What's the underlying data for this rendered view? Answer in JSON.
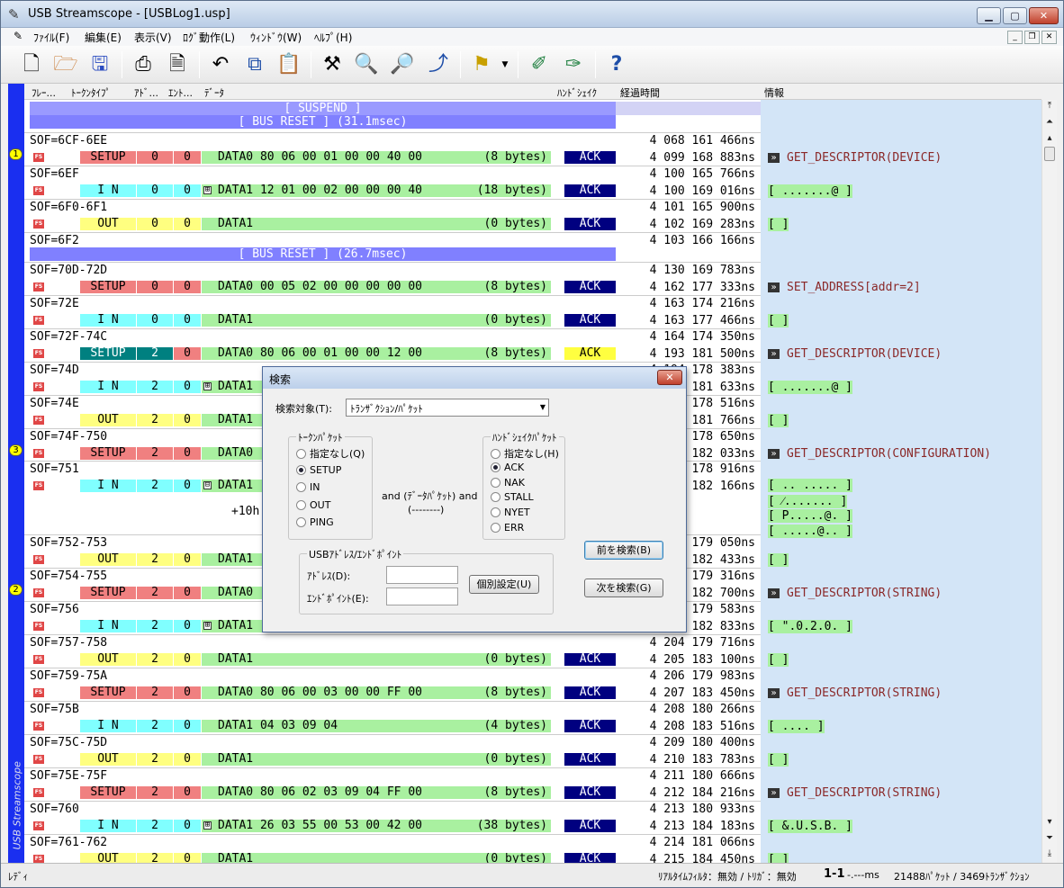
{
  "window": {
    "title": "USB Streamscope - [USBLog1.usp]"
  },
  "menu": [
    "ﾌｧｲﾙ(F)",
    "編集(E)",
    "表示(V)",
    "ﾛｸﾞ動作(L)",
    "ｳｨﾝﾄﾞｳ(W)",
    "ﾍﾙﾌﾟ(H)"
  ],
  "columns": {
    "frame": "ﾌﾚｰ...",
    "token": "ﾄｰｸﾝﾀｲﾌﾟ",
    "addr": "ｱﾄﾞ...",
    "ep": "ｴﾝﾄ...",
    "data": "ﾃﾞｰﾀ",
    "handshake": "ﾊﾝﾄﾞｼｪｲｸ",
    "time": "経過時間",
    "info": "情報"
  },
  "sidebar_label": "USB Streamscope",
  "fs_badge": "FS",
  "banners": [
    {
      "text": "[ SUSPEND ]"
    },
    {
      "text": "[ BUS RESET ] (31.1msec)"
    },
    {
      "text": "[ BUS RESET ] (26.7msec)"
    }
  ],
  "bubbles": [
    "1",
    "3",
    "2"
  ],
  "frames": [
    {
      "sof": "SOF=6CF-6EE",
      "t1": "4 068 161 466ns",
      "pid": "SETUP",
      "addr": "0",
      "ep": "0",
      "data": "DATA0 80 06 00 01 00 00 40 00",
      "size": "(8 bytes)",
      "hs": "ACK",
      "t2": "4 099 168 883ns",
      "info": "GET_DESCRIPTOR(DEVICE)"
    },
    {
      "sof": "SOF=6EF",
      "t1": "4 100 165 766ns",
      "pid": "I N",
      "addr": "0",
      "ep": "0",
      "plus": "⊞",
      "data": "DATA1 12 01 00 02 00 00 00 40",
      "size": "(18 bytes)",
      "hs": "ACK",
      "t2": "4 100 169 016ns",
      "info": "[ .......@ ]"
    },
    {
      "sof": "SOF=6F0-6F1",
      "t1": "4 101 165 900ns",
      "pid": "OUT",
      "addr": "0",
      "ep": "0",
      "data": "DATA1",
      "size": "(0 bytes)",
      "hs": "ACK",
      "t2": "4 102 169 283ns",
      "info": "[  ]"
    },
    {
      "sof": "SOF=6F2",
      "t1": "4 103 166 166ns"
    },
    {
      "sof": "SOF=70D-72D",
      "t1": "4 130 169 783ns",
      "pid": "SETUP",
      "addr": "0",
      "ep": "0",
      "data": "DATA0 00 05 02 00 00 00 00 00",
      "size": "(8 bytes)",
      "hs": "ACK",
      "t2": "4 162 177 333ns",
      "info": "SET_ADDRESS[addr=2]"
    },
    {
      "sof": "SOF=72E",
      "t1": "4 163 174 216ns",
      "pid": "I N",
      "addr": "0",
      "ep": "0",
      "data": "DATA1",
      "size": "(0 bytes)",
      "hs": "ACK",
      "t2": "4 163 177 466ns",
      "info": "[  ]"
    },
    {
      "sof": "SOF=72F-74C",
      "t1": "4 164 174 350ns",
      "pid": "SETUP",
      "addr": "2",
      "ep": "0",
      "data": "DATA0 80 06 00 01 00 00 12 00",
      "size": "(8 bytes)",
      "hs": "ACK",
      "t2": "4 193 181 500ns",
      "info": "GET_DESCRIPTOR(DEVICE)"
    },
    {
      "sof": "SOF=74D",
      "t1": "4 194 178 383ns",
      "pid": "I N",
      "addr": "2",
      "ep": "0",
      "plus": "⊞",
      "data": "DATA1",
      "size": "",
      "hs": "",
      "t2": "4 194 181 633ns",
      "info": "[ .......@ ]"
    },
    {
      "sof": "SOF=74E",
      "t1": "4 195 178 516ns",
      "pid": "OUT",
      "addr": "2",
      "ep": "0",
      "data": "DATA1",
      "size": "",
      "hs": "",
      "t2": "4 196 181 766ns",
      "info": "[  ]"
    },
    {
      "sof": "SOF=74F-750",
      "t1": "4 197 178 650ns",
      "pid": "SETUP",
      "addr": "2",
      "ep": "0",
      "data": "DATA0",
      "size": "",
      "hs": "",
      "t2": "4 198 182 033ns",
      "info": "GET_DESCRIPTOR(CONFIGURATION)"
    },
    {
      "sof": "SOF=751",
      "t1": "4 199 178 916ns",
      "pid": "I N",
      "addr": "2",
      "ep": "0",
      "plus": "⊟",
      "data": "DATA1",
      "size": "",
      "hs": "",
      "t2": "4 200 182 166ns",
      "extra": "+10h",
      "info_lines": [
        "[ .. ..... ]",
        "[ ⁄....... ]",
        "[ P.....@. ]",
        "[ .....@.. ]"
      ]
    },
    {
      "sof": "SOF=752-753",
      "t1": "4 201 179 050ns",
      "pid": "OUT",
      "addr": "2",
      "ep": "0",
      "data": "DATA1",
      "size": "",
      "hs": "",
      "t2": "4 202 182 433ns",
      "info": "[  ]"
    },
    {
      "sof": "SOF=754-755",
      "t1": "4 203 179 316ns",
      "pid": "SETUP",
      "addr": "2",
      "ep": "0",
      "data": "DATA0",
      "size": "",
      "hs": "",
      "t2": "4 203 182 700ns",
      "info": "GET_DESCRIPTOR(STRING)"
    },
    {
      "sof": "SOF=756",
      "t1": "4 204 179 583ns",
      "pid": "I N",
      "addr": "2",
      "ep": "0",
      "plus": "⊞",
      "data": "DATA1",
      "size": "",
      "hs": "",
      "t2": "4 204 182 833ns",
      "info": "[ \".0.2.0. ]"
    },
    {
      "sof": "SOF=757-758",
      "t1": "4 204 179 716ns",
      "pid": "OUT",
      "addr": "2",
      "ep": "0",
      "data": "DATA1",
      "size": "(0 bytes)",
      "hs": "ACK",
      "t2": "4 205 183 100ns",
      "info": "[  ]"
    },
    {
      "sof": "SOF=759-75A",
      "t1": "4 206 179 983ns",
      "pid": "SETUP",
      "addr": "2",
      "ep": "0",
      "data": "DATA0 80 06 00 03 00 00 FF 00",
      "size": "(8 bytes)",
      "hs": "ACK",
      "t2": "4 207 183 450ns",
      "info": "GET_DESCRIPTOR(STRING)"
    },
    {
      "sof": "SOF=75B",
      "t1": "4 208 180 266ns",
      "pid": "I N",
      "addr": "2",
      "ep": "0",
      "data": "DATA1 04 03 09 04",
      "size": "(4 bytes)",
      "hs": "ACK",
      "t2": "4 208 183 516ns",
      "info": "[ .... ]"
    },
    {
      "sof": "SOF=75C-75D",
      "t1": "4 209 180 400ns",
      "pid": "OUT",
      "addr": "2",
      "ep": "0",
      "data": "DATA1",
      "size": "(0 bytes)",
      "hs": "ACK",
      "t2": "4 210 183 783ns",
      "info": "[  ]"
    },
    {
      "sof": "SOF=75E-75F",
      "t1": "4 211 180 666ns",
      "pid": "SETUP",
      "addr": "2",
      "ep": "0",
      "data": "DATA0 80 06 02 03 09 04 FF 00",
      "size": "(8 bytes)",
      "hs": "ACK",
      "t2": "4 212 184 216ns",
      "info": "GET_DESCRIPTOR(STRING)"
    },
    {
      "sof": "SOF=760",
      "t1": "4 213 180 933ns",
      "pid": "I N",
      "addr": "2",
      "ep": "0",
      "plus": "⊞",
      "data": "DATA1 26 03 55 00 53 00 42 00",
      "size": "(38 bytes)",
      "hs": "ACK",
      "t2": "4 213 184 183ns",
      "info": "[ &.U.S.B. ]"
    },
    {
      "sof": "SOF=761-762",
      "t1": "4 214 181 066ns",
      "pid": "OUT",
      "addr": "2",
      "ep": "0",
      "data": "DATA1",
      "size": "(0 bytes)",
      "hs": "ACK",
      "t2": "4 215 184 450ns",
      "info": "[  ]"
    }
  ],
  "colors": {
    "setup": "#f08080",
    "setup_selected": "#008080",
    "in": "#80ffff",
    "out": "#ffff80",
    "data": "#a9f0a0",
    "ack": "#000080",
    "ack_selected": "#ffff40",
    "banner": "#8080ff",
    "info_band": "#d3e5f7",
    "sidebar": "#1a2ff0"
  },
  "dialog": {
    "title": "検索",
    "close": "✕",
    "target_label": "検索対象(T):",
    "target_value": "ﾄﾗﾝｻﾞｸｼｮﾝ/ﾊﾟｹｯﾄ",
    "token_group": "ﾄｰｸﾝﾊﾟｹｯﾄ",
    "token_options": [
      "指定なし(Q)",
      "SETUP",
      "IN",
      "OUT",
      "PING"
    ],
    "token_selected": 1,
    "middle_text": [
      "and (ﾃﾞｰﾀﾊﾟｹｯﾄ) and",
      "(--------)"
    ],
    "handshake_group": "ﾊﾝﾄﾞｼｪｲｸﾊﾟｹｯﾄ",
    "handshake_options": [
      "指定なし(H)",
      "ACK",
      "NAK",
      "STALL",
      "NYET",
      "ERR"
    ],
    "handshake_selected": 1,
    "usb_group": "USBｱﾄﾞﾚｽ/ｴﾝﾄﾞﾎﾟｲﾝﾄ",
    "address_label": "ｱﾄﾞﾚｽ(D):",
    "endpoint_label": "ｴﾝﾄﾞﾎﾟｲﾝﾄ(E):",
    "address_value": "",
    "endpoint_value": "",
    "individual_button": "個別設定(U)",
    "prev_button": "前を検索(B)",
    "next_button": "次を検索(G)"
  },
  "status": {
    "ready": "ﾚﾃﾞｨ",
    "filter": "ﾘｱﾙﾀｲﾑﾌｨﾙﾀ：無効 / ﾄﾘｶﾞ：無効",
    "cursor": "1-1",
    "ms": "-.---ms",
    "packets": "21488ﾊﾟｹｯﾄ / 3469ﾄﾗﾝｻﾞｸｼｮﾝ"
  }
}
